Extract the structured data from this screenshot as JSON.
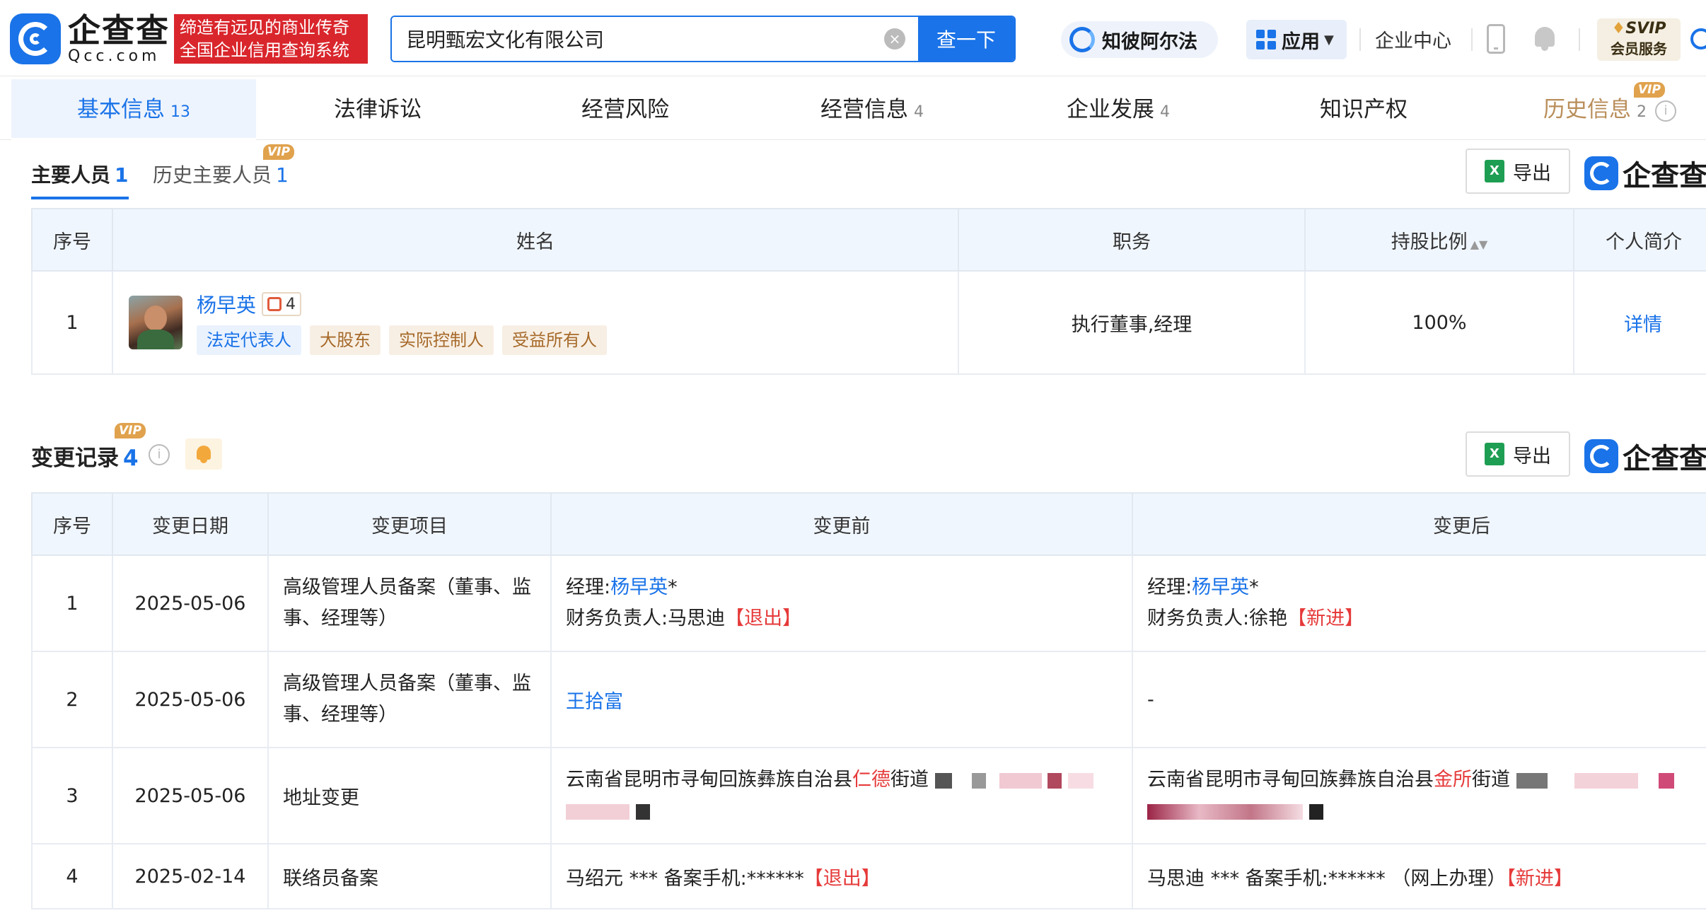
{
  "header": {
    "logo_cn": "企查查",
    "logo_en": "Qcc.com",
    "slogan_line1": "缔造有远见的商业传奇",
    "slogan_line2": "全国企业信用查询系统",
    "search_value": "昆明甄宏文化有限公司",
    "search_button": "查一下",
    "ai_label": "知彼阿尔法",
    "apps_label": "应用",
    "enterprise_center": "企业中心",
    "svip_top": "SVIP",
    "svip_bottom": "会员服务"
  },
  "tabs": [
    {
      "label": "基本信息",
      "count": "13"
    },
    {
      "label": "法律诉讼",
      "count": ""
    },
    {
      "label": "经营风险",
      "count": ""
    },
    {
      "label": "经营信息",
      "count": "4"
    },
    {
      "label": "企业发展",
      "count": "4"
    },
    {
      "label": "知识产权",
      "count": ""
    },
    {
      "label": "历史信息",
      "count": "2"
    }
  ],
  "vip_label": "VIP",
  "brand_text": "企查查",
  "personnel": {
    "tab_main": "主要人员",
    "tab_main_count": "1",
    "tab_history": "历史主要人员",
    "tab_history_count": "1",
    "export_label": "导出",
    "columns": [
      "序号",
      "姓名",
      "职务",
      "持股比例",
      "个人简介"
    ],
    "rows": [
      {
        "index": "1",
        "name": "杨早英",
        "relation_count": "4",
        "tags": [
          "法定代表人",
          "大股东",
          "实际控制人",
          "受益所有人"
        ],
        "position": "执行董事,经理",
        "share": "100%",
        "detail": "详情"
      }
    ]
  },
  "changes": {
    "title": "变更记录",
    "count": "4",
    "export_label": "导出",
    "columns": [
      "序号",
      "变更日期",
      "变更项目",
      "变更前",
      "变更后"
    ],
    "rows": [
      {
        "index": "1",
        "date": "2025-05-06",
        "item": "高级管理人员备案（董事、监事、经理等）",
        "before_l1_prefix": "经理:",
        "before_l1_name": "杨早英",
        "before_l1_suffix": "*",
        "before_l2_text": "财务负责人:马思迪",
        "before_l2_flag": "【退出】",
        "after_l1_prefix": "经理:",
        "after_l1_name": "杨早英",
        "after_l1_suffix": "*",
        "after_l2_text": "财务负责人:徐艳",
        "after_l2_flag": "【新进】"
      },
      {
        "index": "2",
        "date": "2025-05-06",
        "item": "高级管理人员备案（董事、监事、经理等）",
        "before_name": "王拾富",
        "after_text": "-"
      },
      {
        "index": "3",
        "date": "2025-05-06",
        "item": "地址变更",
        "before_prefix": "云南省昆明市寻甸回族彝族自治县",
        "before_highlight": "仁德",
        "before_suffix": "街道",
        "after_prefix": "云南省昆明市寻甸回族彝族自治县",
        "after_highlight": "金所",
        "after_suffix": "街道"
      },
      {
        "index": "4",
        "date": "2025-02-14",
        "item": "联络员备案",
        "before_text": "马绍元 *** 备案手机:******",
        "before_flag": "【退出】",
        "after_text": "马思迪 *** 备案手机:****** （网上办理）",
        "after_flag": "【新进】"
      }
    ]
  },
  "colors": {
    "primary": "#1a73e8",
    "slogan_bg": "#d9262c",
    "highlight_red": "#e63a3a",
    "vip_gold": "#e0a24d"
  },
  "icons": [
    "logo-icon",
    "clear-icon",
    "ai-icon",
    "apps-grid-icon",
    "phone-icon",
    "bell-icon",
    "svip-icon",
    "search-icon",
    "excel-icon",
    "relation-icon",
    "info-icon",
    "alert-bell-icon",
    "sort-icon"
  ]
}
